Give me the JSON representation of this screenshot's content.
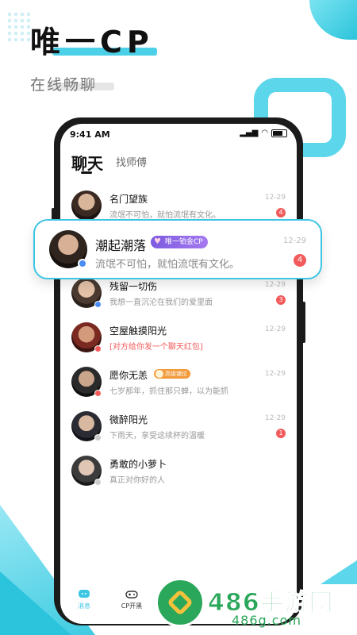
{
  "header": {
    "title": "唯一CP",
    "subtitle": "在线畅聊"
  },
  "status_bar": {
    "time": "9:41 AM"
  },
  "tabs": [
    {
      "label": "聊天",
      "active": true
    },
    {
      "label": "找师傅",
      "active": false
    }
  ],
  "conversations": [
    {
      "name": "名门望族",
      "message": "流氓不可怕，就怕流氓有文化。",
      "time": "12-29",
      "badge": "4",
      "dot_color": ""
    },
    {
      "name": "潮起潮落",
      "message": "流氓不可怕，就怕流氓有文化。",
      "time": "12-29",
      "badge": "4",
      "dot_color": "#4b8cf5"
    },
    {
      "name": "残留一切伤",
      "message": "我想一直沉沦在我们的爱里面",
      "time": "12-29",
      "badge": "3",
      "dot_color": "#4b8cf5"
    },
    {
      "name": "空屋触摸阳光",
      "message": "[对方给你发一个聊天红包]",
      "time": "12-29",
      "badge": "",
      "dot_color": "#f25b5b"
    },
    {
      "name": "愿你无恙",
      "message": "七岁那年，抓住那只蝉，以为能抓",
      "time": "12-29",
      "badge": "",
      "dot_color": "#f25b5b",
      "tag": "高级铺位"
    },
    {
      "name": "微醉阳光",
      "message": "下雨天，享受这续杯的温暖",
      "time": "12-29",
      "badge": "1",
      "dot_color": "#cccccc"
    },
    {
      "name": "勇敢的小萝卜",
      "message": "真正对你好的人",
      "time": "",
      "badge": "",
      "dot_color": "#cccccc"
    }
  ],
  "highlight_card": {
    "name": "潮起潮落",
    "tag": "唯一铂金CP",
    "message": "流氓不可怕，就怕流氓有文化。",
    "time": "12-29",
    "badge": "4"
  },
  "nav": [
    {
      "label": "消息",
      "icon": "chat-bubble-icon",
      "active": true
    },
    {
      "label": "CP开黑",
      "icon": "gamepad-icon",
      "active": false
    }
  ],
  "watermark": {
    "text": "486手游网",
    "sub": "486g.com"
  },
  "colors": {
    "accent": "#3dc6e4",
    "badge": "#f25b5b",
    "watermark": "#2aa75a"
  }
}
